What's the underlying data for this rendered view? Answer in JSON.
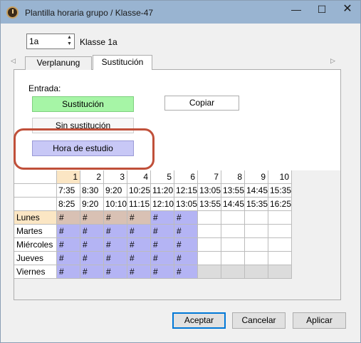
{
  "window": {
    "title": "Plantilla horaria grupo / Klasse-47",
    "controls": {
      "minimize": "—",
      "maximize": "☐",
      "close": "✕"
    }
  },
  "class_selector": {
    "value": "1a",
    "name": "Klasse 1a"
  },
  "tabs": [
    {
      "label": "Verplanung",
      "active": false
    },
    {
      "label": "Sustitución",
      "active": true
    }
  ],
  "entrada": {
    "label": "Entrada:",
    "buttons": [
      {
        "label": "Sustitución",
        "color": "#a6f5a6"
      },
      {
        "label": "Sin sustitución",
        "color": "#f7f7f7"
      },
      {
        "label": "Hora de estudio",
        "color": "#c8c8f6"
      }
    ],
    "copy_label": "Copiar"
  },
  "grid": {
    "periods": [
      "1",
      "2",
      "3",
      "4",
      "5",
      "6",
      "7",
      "8",
      "9",
      "10"
    ],
    "start_times": [
      "7:35",
      "8:30",
      "9:20",
      "10:25",
      "11:20",
      "12:15",
      "13:05",
      "13:55",
      "14:45",
      "15:35"
    ],
    "end_times": [
      "8:25",
      "9:20",
      "10:10",
      "11:15",
      "12:10",
      "13:05",
      "13:55",
      "14:45",
      "15:35",
      "16:25"
    ],
    "days": [
      "Lunes",
      "Martes",
      "Miércoles",
      "Jueves",
      "Viernes"
    ],
    "active_period": "1",
    "active_day": "Lunes",
    "colors": {
      "tan": "#d9c1b4",
      "blue": "#b4b4f4",
      "white": "#ffffff",
      "gray": "#dcdcdc"
    },
    "rows": [
      {
        "marks": [
          "#",
          "#",
          "#",
          "#",
          "#",
          "#",
          "",
          "",
          "",
          ""
        ],
        "fill": [
          "tan",
          "tan",
          "tan",
          "tan",
          "blue",
          "blue",
          "white",
          "white",
          "white",
          "white"
        ]
      },
      {
        "marks": [
          "#",
          "#",
          "#",
          "#",
          "#",
          "#",
          "",
          "",
          "",
          ""
        ],
        "fill": [
          "blue",
          "blue",
          "blue",
          "blue",
          "blue",
          "blue",
          "white",
          "white",
          "white",
          "white"
        ]
      },
      {
        "marks": [
          "#",
          "#",
          "#",
          "#",
          "#",
          "#",
          "",
          "",
          "",
          ""
        ],
        "fill": [
          "blue",
          "blue",
          "blue",
          "blue",
          "blue",
          "blue",
          "white",
          "white",
          "white",
          "white"
        ]
      },
      {
        "marks": [
          "#",
          "#",
          "#",
          "#",
          "#",
          "#",
          "",
          "",
          "",
          ""
        ],
        "fill": [
          "blue",
          "blue",
          "blue",
          "blue",
          "blue",
          "blue",
          "white",
          "white",
          "white",
          "white"
        ]
      },
      {
        "marks": [
          "#",
          "#",
          "#",
          "#",
          "#",
          "#",
          "",
          "",
          "",
          ""
        ],
        "fill": [
          "blue",
          "blue",
          "blue",
          "blue",
          "blue",
          "blue",
          "gray",
          "gray",
          "gray",
          "gray"
        ]
      }
    ]
  },
  "footer": {
    "accept": "Aceptar",
    "cancel": "Cancelar",
    "apply": "Aplicar"
  }
}
